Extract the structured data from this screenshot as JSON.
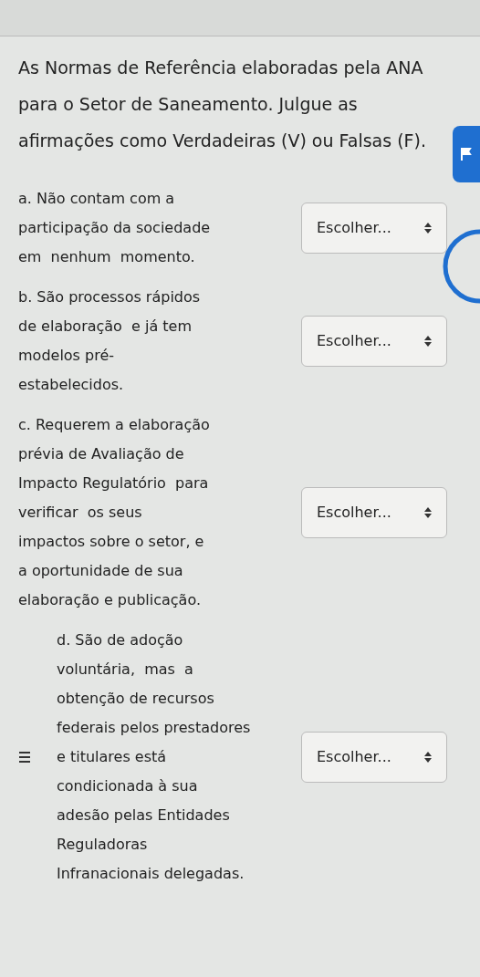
{
  "question": "As Normas de Referência elaboradas pela ANA para o Setor de Saneamento. Julgue as afirmações como Verdadeiras (V) ou Falsas (F).",
  "items": [
    {
      "lines": [
        "a. Não contam com a",
        "participação da sociedade",
        "em  nenhum  momento."
      ],
      "choice": "Escolher...",
      "menu_icon": false
    },
    {
      "lines": [
        "b. São processos rápidos",
        "de elaboração  e já tem",
        "modelos pré-",
        "estabelecidos."
      ],
      "choice": "Escolher...",
      "menu_icon": false
    },
    {
      "lines": [
        "c. Requerem a elaboração",
        "prévia de Avaliação de",
        "Impacto Regulatório  para",
        "verificar  os seus",
        "impactos sobre o setor, e",
        "a oportunidade de sua",
        "elaboração e publicação."
      ],
      "choice": "Escolher...",
      "menu_icon": false
    },
    {
      "lines": [
        "d. São de adoção",
        "voluntária,  mas  a",
        "obtenção de recursos",
        "federais pelos prestadores",
        "e titulares está",
        "condicionada à sua",
        "adesão pelas Entidades",
        "Reguladoras",
        "Infranacionais delegadas."
      ],
      "choice": "Escolher...",
      "menu_icon": true
    }
  ]
}
